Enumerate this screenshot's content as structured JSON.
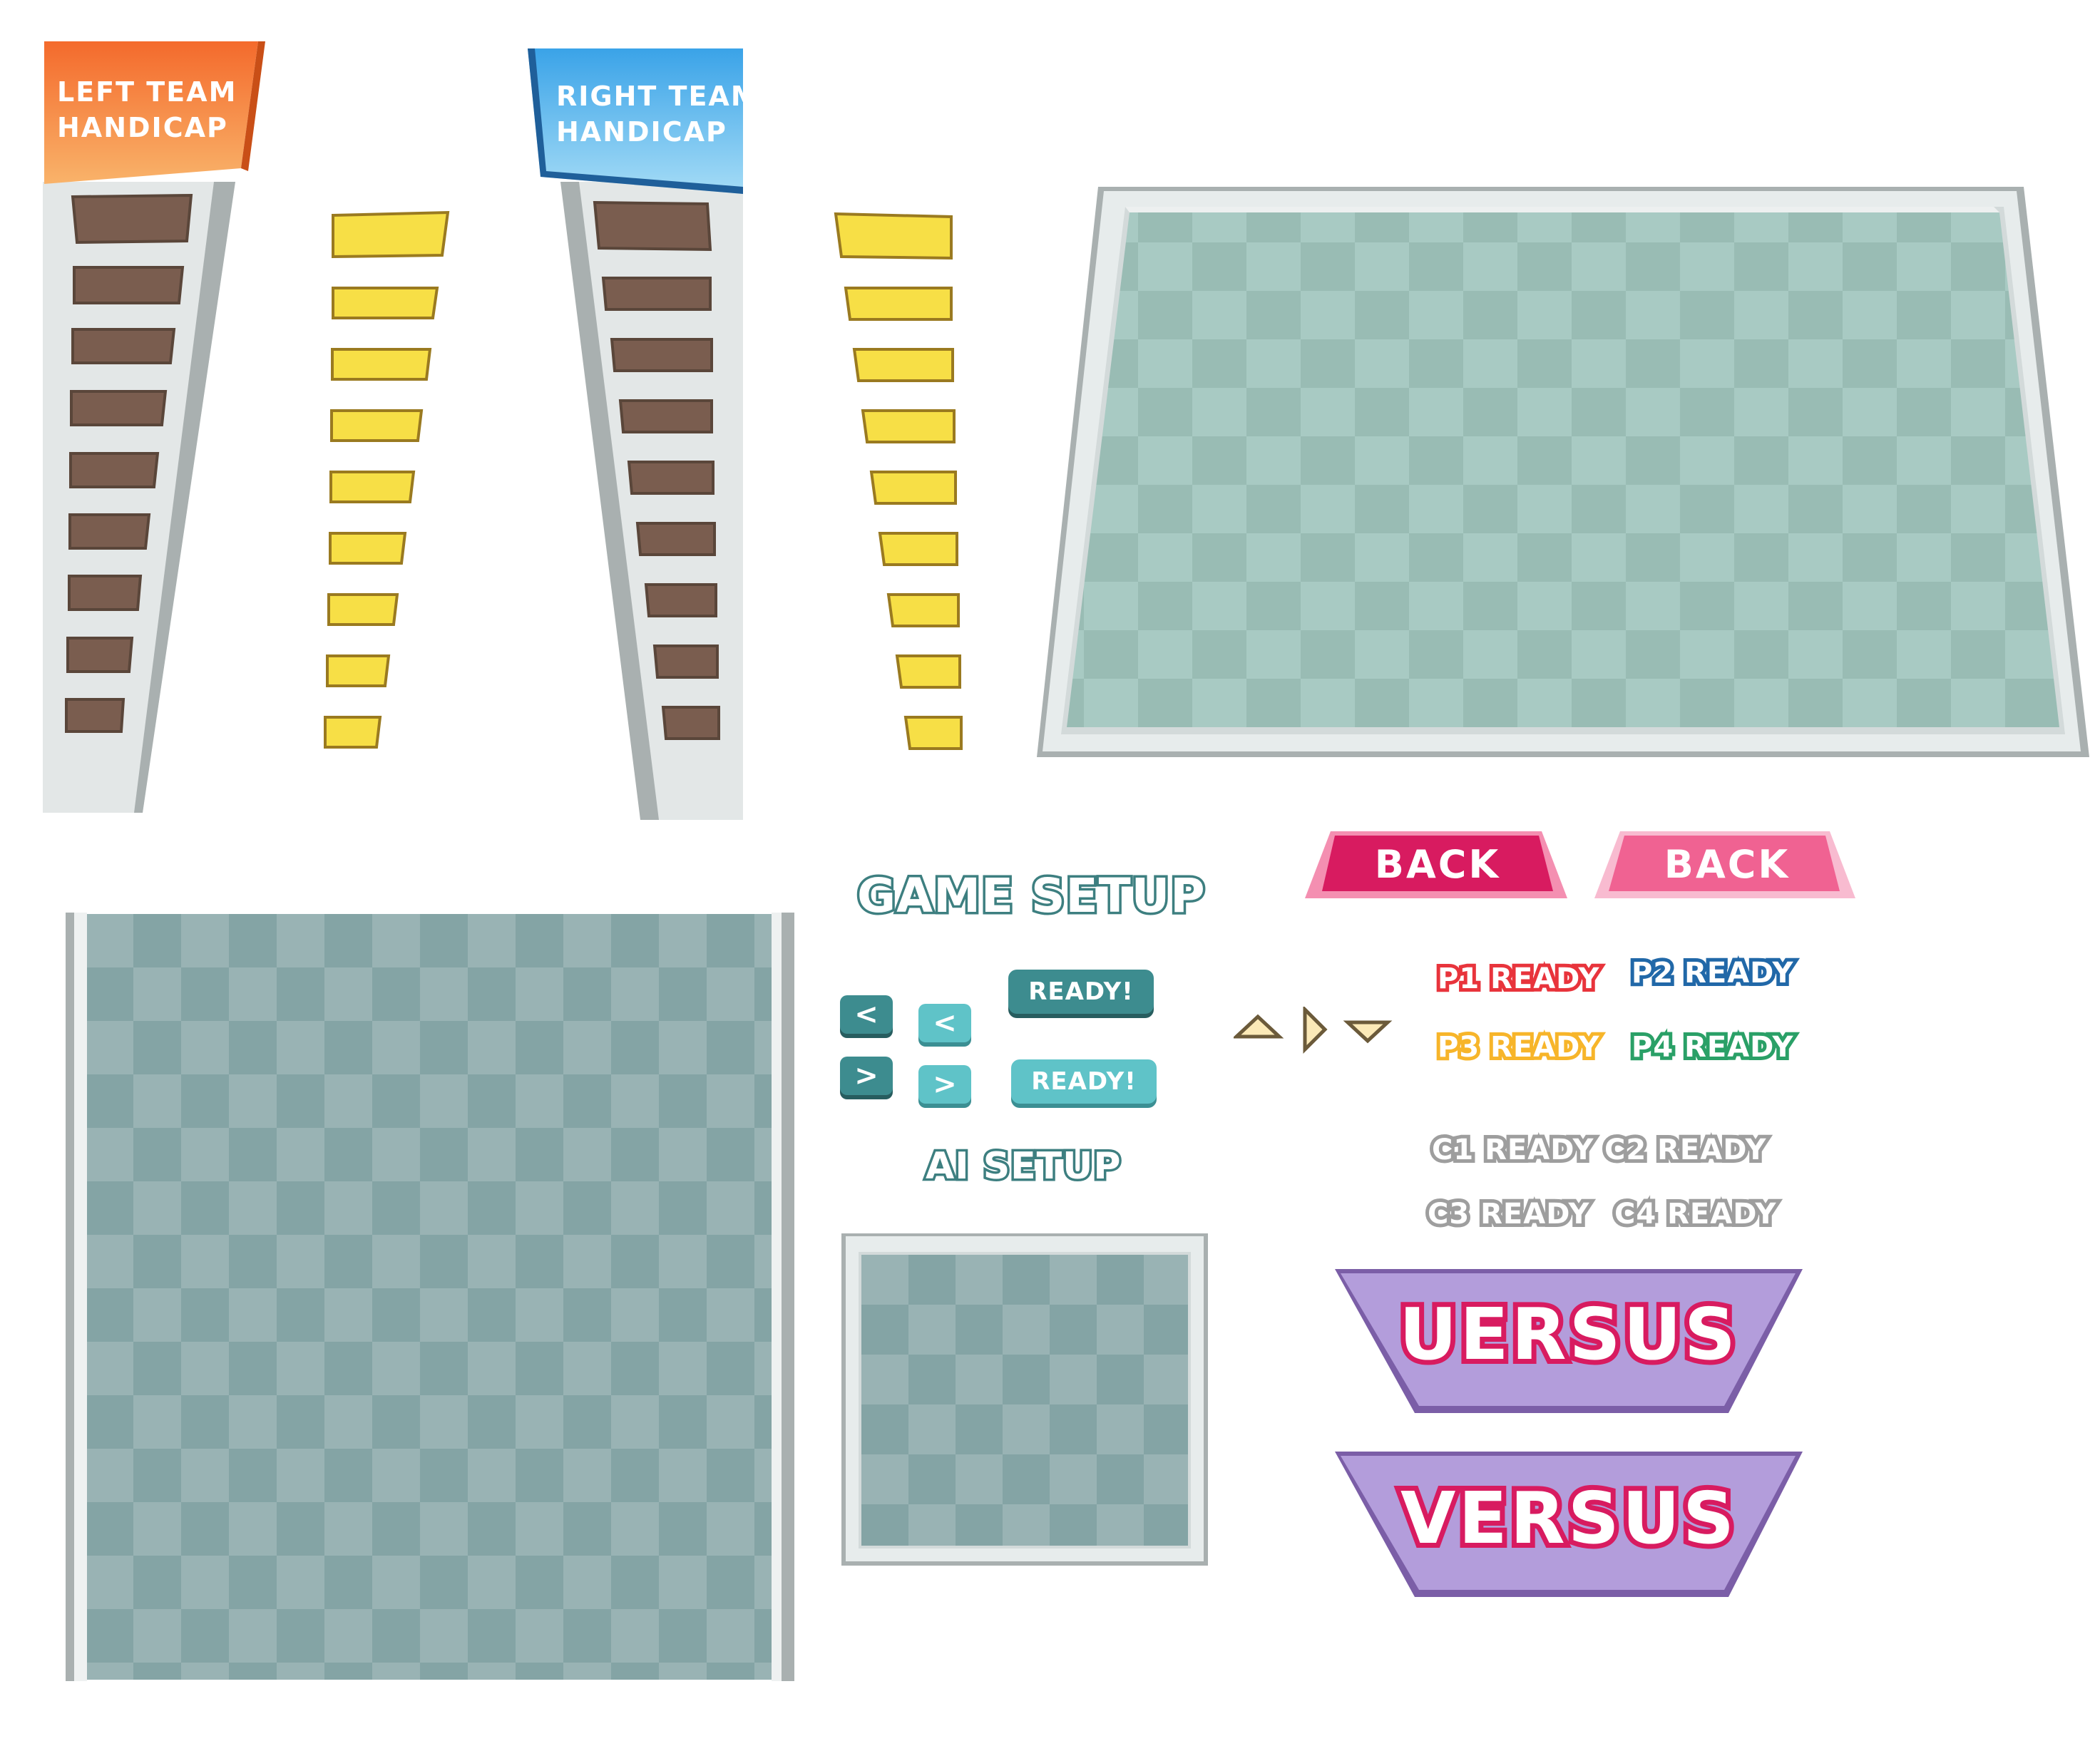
{
  "left_panel": {
    "header": [
      "LEFT TEAM",
      "HANDICAP"
    ],
    "colors": {
      "header_top": "#f46a2c",
      "header_bottom": "#f9b36a",
      "slot": "#7a5d4f",
      "bar": "#e3e7e7"
    }
  },
  "right_panel": {
    "header": [
      "RIGHT TEAM",
      "HANDICAP"
    ],
    "colors": {
      "header_top": "#3aa3e8",
      "header_bottom": "#94d5f5",
      "slot": "#7a5d4f",
      "bar": "#e3e7e7"
    }
  },
  "handicap_levels": 9,
  "yellow_pip_color": "#f7df46",
  "game_setup_title": "GAME SETUP",
  "ai_setup_title": "AI SETUP",
  "buttons": {
    "prev": "<",
    "next": ">",
    "ready": "READY!",
    "back": "BACK"
  },
  "triangle_icons": [
    "up-triangle-icon",
    "right-triangle-icon",
    "down-triangle-icon"
  ],
  "player_ready": [
    {
      "label": "P1 READY",
      "color": "#e8343c"
    },
    {
      "label": "P2 READY",
      "color": "#2168a8"
    },
    {
      "label": "P3 READY",
      "color": "#f7b52a"
    },
    {
      "label": "P4 READY",
      "color": "#2aa067"
    }
  ],
  "cpu_ready": [
    {
      "label": "C1 READY"
    },
    {
      "label": "C2 READY"
    },
    {
      "label": "C3 READY"
    },
    {
      "label": "C4 READY"
    }
  ],
  "versus": [
    "UERSUS",
    "VERSUS"
  ],
  "colors": {
    "teal_dark": "#3d8c8f",
    "teal_light": "#5fc3c8",
    "back_dark": "#d81b60",
    "back_light": "#f06292",
    "versus_bg": "#b39ddb",
    "board_bg": "#9cc0b9"
  }
}
